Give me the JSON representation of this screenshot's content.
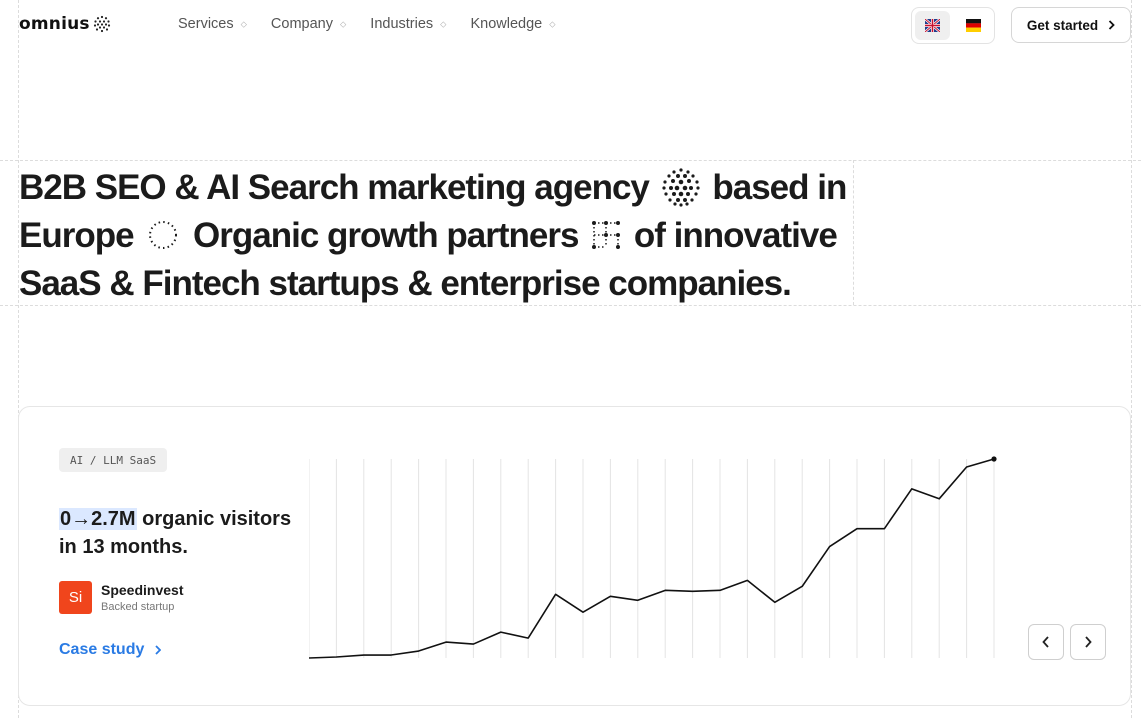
{
  "header": {
    "logo_text": "omnius",
    "nav": [
      {
        "label": "Services"
      },
      {
        "label": "Company"
      },
      {
        "label": "Industries"
      },
      {
        "label": "Knowledge"
      }
    ],
    "cta_label": "Get started"
  },
  "hero": {
    "line1_a": "B2B SEO & AI Search marketing agency",
    "line1_b": "based in",
    "line2_a": "Europe",
    "line2_b": "Organic growth partners",
    "line2_c": "of innovative",
    "line3": "SaaS & Fintech startups & enterprise companies."
  },
  "case": {
    "tag": "AI / LLM SaaS",
    "stat_highlight": "0→2.7M",
    "stat_rest": "organic visitors in 13 months.",
    "company_logo_text": "Si",
    "company_name": "Speedinvest",
    "company_sub": "Backed startup",
    "link_label": "Case study"
  },
  "colors": {
    "accent": "#2a7be4",
    "brand_logo_bg": "#f0451c",
    "highlight": "#dbe8ff"
  },
  "chart_data": {
    "type": "line",
    "title": "",
    "xlabel": "",
    "ylabel": "",
    "grid": "vertical",
    "series": [
      {
        "values": [
          0,
          0.005,
          0.015,
          0.015,
          0.035,
          0.08,
          0.07,
          0.13,
          0.1,
          0.32,
          0.23,
          0.31,
          0.29,
          0.34,
          0.335,
          0.34,
          0.39,
          0.28,
          0.36,
          0.56,
          0.65,
          0.65,
          0.85,
          0.8,
          0.96,
          1.0
        ]
      }
    ],
    "ylim": [
      0,
      1
    ]
  }
}
